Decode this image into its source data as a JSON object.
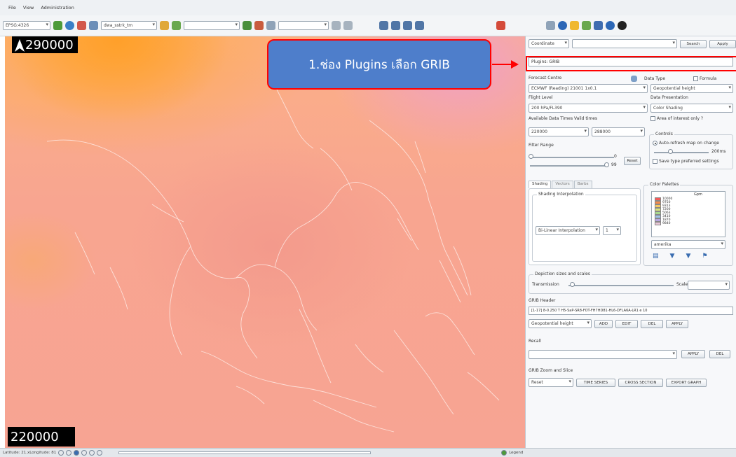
{
  "menu": {
    "items": [
      "File",
      "View",
      "Administration"
    ]
  },
  "toolbar": {
    "combo_projection": "EPSG:4326",
    "combo_layer": "dwa_sstrk_tm",
    "combo_scale": "",
    "combo_overlay": ""
  },
  "map": {
    "top_value": "290000",
    "bottom_value": "220000"
  },
  "callout": {
    "text": "1.ช่อง Plugins เลือก GRIB"
  },
  "panel": {
    "coordinate_label": "Coordinate",
    "search_button": "Search",
    "apply_button": "Apply",
    "plugins_label": "Plugins: GRIB",
    "forecast_centre_label": "Forecast Centre",
    "forecast_centre_value": "ECMWF (Reading) 21001 1x0.1",
    "flight_level_label": "Flight Level",
    "flight_level_value": "200 hPa/FL390",
    "data_type_label": "Data Type",
    "formula_label": "Formula",
    "data_type_value": "Geopotential height",
    "data_presentation_label": "Data Presentation",
    "data_presentation_value": "Color Shading",
    "avail_times_label": "Available Data Times  Valid times",
    "time_value_1": "220000",
    "time_value_2": "288000",
    "area_interest_label": "Area of interest only ?",
    "controls_label": "Controls",
    "auto_refresh_label": "Auto-refresh map on change",
    "ms_label": "200ms",
    "save_type_label": "Save type preferred settings",
    "filter_range_label": "Filter Range",
    "filter_min": "0",
    "filter_max": "99",
    "filter_reset": "Reset",
    "tab_shading": "Shading",
    "tab_vectors": "Vectors",
    "tab_barbs": "Barbs",
    "shading_interp_label": "Shading Interpolation",
    "interp_value": "Bi-Linear Interpolation",
    "interp_num": "1",
    "color_palettes_label": "Color Palettes",
    "palette_title": "Gpm",
    "palette_values": [
      "10000",
      "9750",
      "9313",
      "7200",
      "5063",
      "3410",
      "1870",
      "9840"
    ],
    "palette_colors": [
      "#f25a5a",
      "#f48a4a",
      "#f5c860",
      "#d9e27a",
      "#a6d98e",
      "#9ec3e6",
      "#b9a6e3",
      "#e7c6d6"
    ],
    "palette_select": "amerika",
    "depiction_label": "Depiction sizes and scales",
    "transmission_label": "Transmission",
    "scale_label": "Scale",
    "grib_header_label": "GRIB Header",
    "grib_header_text": "[1-17] 8-0.250 T H5-SaP-SR8-FOT-FH7HD81-HL6-DFLA6A-LR1 e 10",
    "grib_param_value": "Geopotential height",
    "btn_add": "ADD",
    "btn_edit": "EDIT",
    "btn_del": "DEL",
    "btn_apply": "APPLY",
    "recall_label": "Recall",
    "recall_apply": "APPLY",
    "recall_del": "DEL",
    "zoom_slice_label": "GRIB Zoom and Slice",
    "zoom_value": "Reset",
    "btn_time_series": "TIME SERIES",
    "btn_cross_section": "CROSS SECTION",
    "btn_export_graph": "EXPORT GRAPH"
  },
  "status": {
    "coords": "Latitude: 21.xLongitude: 81",
    "legend": "Legend"
  }
}
